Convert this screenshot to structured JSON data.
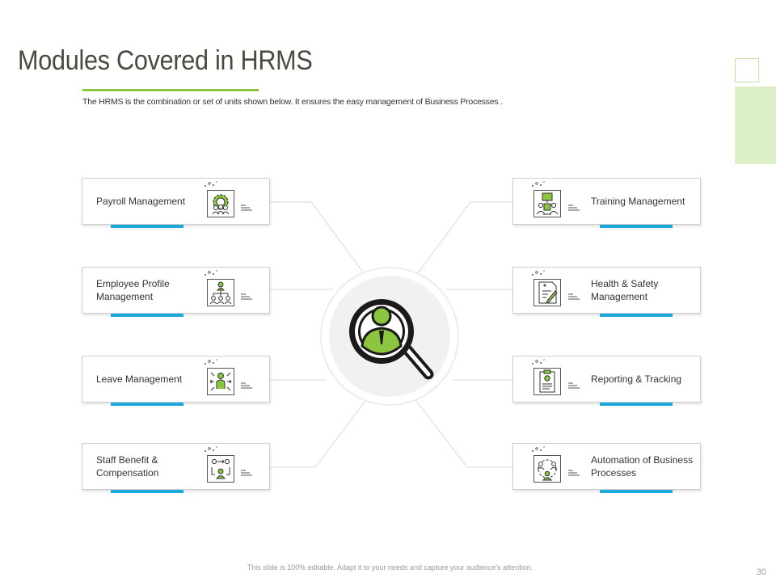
{
  "slide": {
    "title": "Modules Covered in HRMS",
    "subtitle": "The HRMS is the combination or set of units shown below. It ensures the easy management of Business Processes .",
    "footer": "This slide is 100% editable. Adapt it to your needs and capture your audience's attention.",
    "page_number": "30"
  },
  "colors": {
    "accent_green": "#8cc63f",
    "accent_blue": "#1ba8dc",
    "hub_gray": "#f1f1f1"
  },
  "hub": {
    "icon": "magnifier-person-icon"
  },
  "modules_left": [
    {
      "label": "Payroll Management",
      "icon": "gear-people-icon"
    },
    {
      "label": "Employee Profile Management",
      "icon": "org-chart-icon"
    },
    {
      "label": "Leave Management",
      "icon": "person-arrows-icon"
    },
    {
      "label": "Staff Benefit & Compensation",
      "icon": "exchange-people-icon"
    }
  ],
  "modules_right": [
    {
      "label": "Training Management",
      "icon": "presentation-icon"
    },
    {
      "label": "Health & Safety Management",
      "icon": "medical-report-icon"
    },
    {
      "label": "Reporting & Tracking",
      "icon": "clipboard-icon"
    },
    {
      "label": "Automation of Business Processes",
      "icon": "network-people-icon"
    }
  ]
}
